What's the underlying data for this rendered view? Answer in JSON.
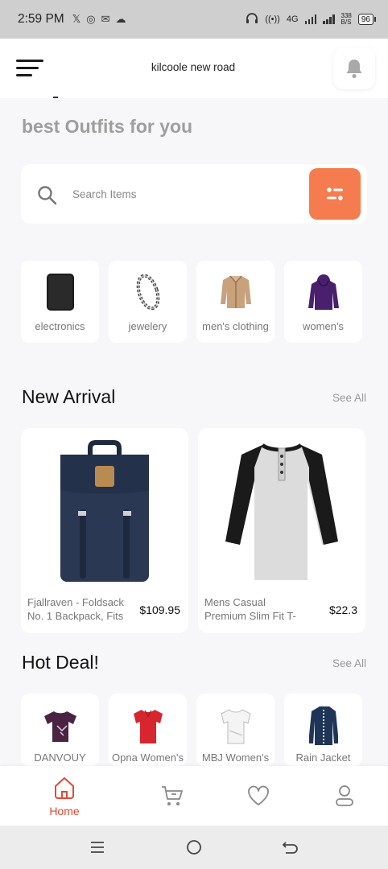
{
  "status_bar": {
    "time": "2:59 PM",
    "network_type": "4G",
    "data_speed": "338\nB/S",
    "battery": "96"
  },
  "header": {
    "location": "kilcoole new road"
  },
  "headline": "best Outfits for you",
  "search": {
    "placeholder": "Search Items"
  },
  "categories": [
    {
      "label": "electronics",
      "icon": "tablet-icon"
    },
    {
      "label": "jewelery",
      "icon": "bracelet-icon"
    },
    {
      "label": "men's clothing",
      "icon": "jacket-icon"
    },
    {
      "label": "women's",
      "icon": "hoodie-icon"
    }
  ],
  "new_arrival": {
    "title": "New Arrival",
    "see_all": "See All",
    "products": [
      {
        "name": "Fjallraven - Foldsack No. 1 Backpack, Fits",
        "price": "$109.95",
        "icon": "backpack-icon"
      },
      {
        "name": "Mens Casual Premium Slim Fit T-",
        "price": "$22.3",
        "icon": "tshirt-icon"
      }
    ]
  },
  "hot_deal": {
    "title": "Hot Deal!",
    "see_all": "See All",
    "items": [
      {
        "label": "DANVOUY",
        "icon": "tshirt-icon"
      },
      {
        "label": "Opna Women's",
        "icon": "tshirt-icon"
      },
      {
        "label": "MBJ Women's",
        "icon": "tshirt-icon"
      },
      {
        "label": "Rain Jacket",
        "icon": "coat-icon"
      }
    ]
  },
  "bottom_nav": {
    "home_label": "Home"
  },
  "colors": {
    "accent": "#f47c4f",
    "active_nav": "#e24a33",
    "background": "#f7f7fa"
  }
}
